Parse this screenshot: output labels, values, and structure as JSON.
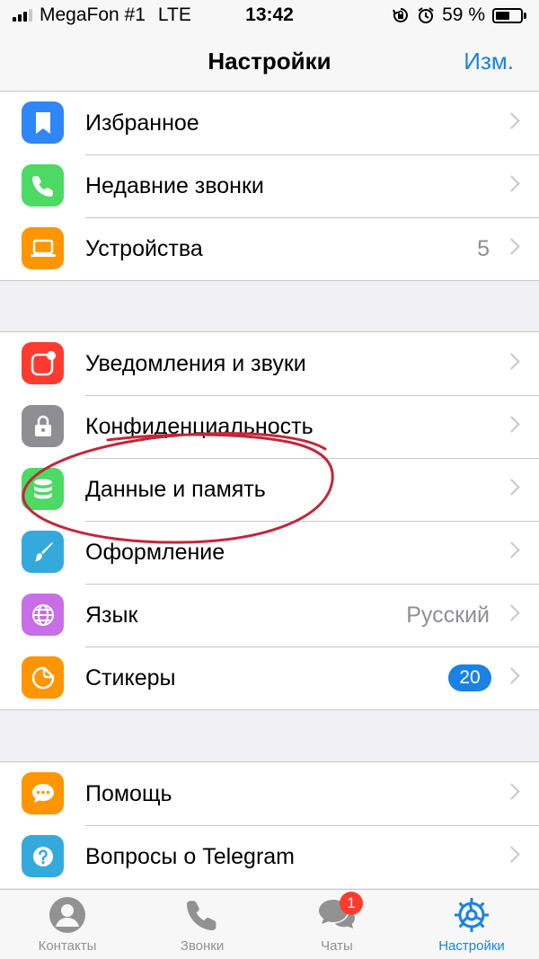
{
  "status_bar": {
    "carrier": "MegaFon #1",
    "network": "LTE",
    "time": "13:42",
    "battery": "59 %",
    "battery_level": 0.59
  },
  "nav": {
    "title": "Настройки",
    "edit_label": "Изм."
  },
  "groups": [
    [
      {
        "label": "Избранное",
        "icon": "bookmark-icon",
        "color": "#2f86f6"
      },
      {
        "label": "Недавние звонки",
        "icon": "phone-icon",
        "color": "#4cd964"
      },
      {
        "label": "Устройства",
        "icon": "laptop-icon",
        "color": "#ff9500",
        "value": "5"
      }
    ],
    [
      {
        "label": "Уведомления и звуки",
        "icon": "notification-icon",
        "color": "#ff3b30"
      },
      {
        "label": "Конфиденциальность",
        "icon": "lock-icon",
        "color": "#8e8e93"
      },
      {
        "label": "Данные и память",
        "icon": "database-icon",
        "color": "#4cd964"
      },
      {
        "label": "Оформление",
        "icon": "brush-icon",
        "color": "#34aadc"
      },
      {
        "label": "Язык",
        "icon": "globe-icon",
        "color": "#c86ee6",
        "value": "Русский"
      },
      {
        "label": "Стикеры",
        "icon": "sticker-icon",
        "color": "#ff9500",
        "badge": "20"
      }
    ],
    [
      {
        "label": "Помощь",
        "icon": "chat-bubble-icon",
        "color": "#ff9500"
      },
      {
        "label": "Вопросы о Telegram",
        "icon": "question-icon",
        "color": "#34aadc"
      }
    ]
  ],
  "tabs": [
    {
      "label": "Контакты",
      "icon": "person-icon",
      "active": false
    },
    {
      "label": "Звонки",
      "icon": "phone-icon",
      "active": false
    },
    {
      "label": "Чаты",
      "icon": "chats-icon",
      "active": false,
      "badge": "1"
    },
    {
      "label": "Настройки",
      "icon": "gear-icon",
      "active": true
    }
  ],
  "colors": {
    "accent": "#1a82e2",
    "badge_red": "#ff3b30",
    "annotation": "#c3263a"
  }
}
